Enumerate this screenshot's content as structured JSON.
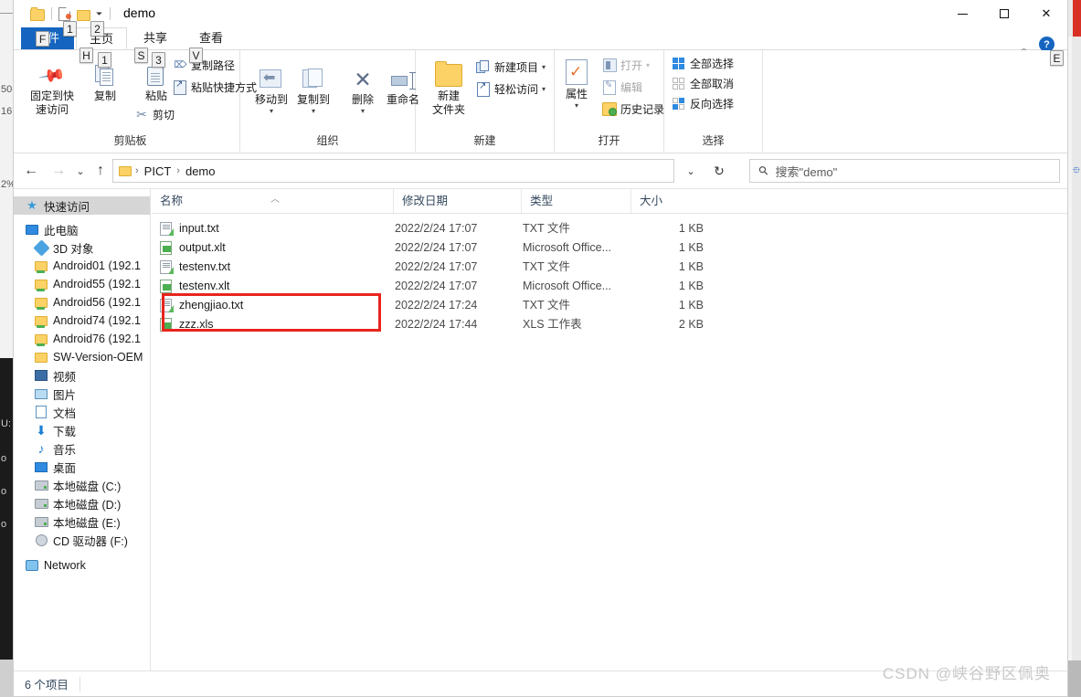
{
  "window": {
    "title": "demo",
    "minimize_label": "最小化",
    "maximize_label": "最大化",
    "close_label": "关闭",
    "help_label": "?",
    "help_keytip": "E",
    "collapse_ribbon_label": "︿"
  },
  "quick_access_toolbar": {
    "items": [
      {
        "name": "folder-icon",
        "keytip": ""
      },
      {
        "name": "properties-icon",
        "keytip": "1"
      },
      {
        "name": "new-folder-icon",
        "keytip": "2"
      }
    ],
    "dropdown_label": "⏷"
  },
  "ribbon": {
    "tabs": [
      {
        "label": "文件",
        "keytip": "F",
        "active": false
      },
      {
        "label": "主页",
        "keytip": "H",
        "active": true
      },
      {
        "label": "共享",
        "keytip": "S",
        "active": false
      },
      {
        "label": "查看",
        "keytip": "V",
        "active": false
      }
    ],
    "groups": [
      {
        "label": "剪贴板",
        "big_buttons": [
          {
            "label": "固定到快\n速访问",
            "line1": "固定到快",
            "line2": "速访问",
            "icon": "pin-icon"
          },
          {
            "label": "复制",
            "icon": "copy-icon",
            "keytip": "1"
          },
          {
            "label": "粘贴",
            "icon": "paste-icon",
            "keytip": "3"
          }
        ],
        "small_buttons": [
          {
            "label": "剪切",
            "icon": "scissors-icon"
          },
          {
            "label": "复制路径",
            "icon": "copy-path-icon"
          },
          {
            "label": "粘贴快捷方式",
            "icon": "paste-shortcut-icon"
          }
        ]
      },
      {
        "label": "组织",
        "big_buttons": [
          {
            "label": "移动到",
            "icon": "move-to-icon",
            "has_caret": true
          },
          {
            "label": "复制到",
            "icon": "copy-to-icon",
            "has_caret": true
          },
          {
            "label": "删除",
            "icon": "delete-icon",
            "has_caret": true
          },
          {
            "label": "重命名",
            "icon": "rename-icon"
          }
        ]
      },
      {
        "label": "新建",
        "big_buttons": [
          {
            "label": "新建\n文件夹",
            "line1": "新建",
            "line2": "文件夹",
            "icon": "new-folder-icon"
          }
        ],
        "small_buttons": [
          {
            "label": "新建项目",
            "icon": "new-item-icon",
            "has_caret": true
          },
          {
            "label": "轻松访问",
            "icon": "easy-access-icon",
            "has_caret": true
          }
        ]
      },
      {
        "label": "打开",
        "big_buttons": [
          {
            "label": "属性",
            "icon": "properties-icon",
            "has_caret": true
          }
        ],
        "small_buttons": [
          {
            "label": "打开",
            "icon": "open-icon",
            "has_caret": true,
            "disabled": true
          },
          {
            "label": "编辑",
            "icon": "edit-icon",
            "disabled": true
          },
          {
            "label": "历史记录",
            "icon": "history-icon"
          }
        ]
      },
      {
        "label": "选择",
        "small_buttons": [
          {
            "label": "全部选择",
            "icon": "select-all-icon"
          },
          {
            "label": "全部取消",
            "icon": "select-none-icon"
          },
          {
            "label": "反向选择",
            "icon": "invert-selection-icon"
          }
        ]
      }
    ]
  },
  "navigation": {
    "back_label": "←",
    "forward_label": "→",
    "recent_label": "⌄",
    "up_label": "↑",
    "breadcrumb": [
      "PICT",
      "demo"
    ],
    "breadcrumb_separator": "›",
    "address_dropdown_label": "⌄",
    "refresh_label": "↻"
  },
  "search": {
    "placeholder": "搜索\"demo\"",
    "icon": "search-icon"
  },
  "sidebar": {
    "items": [
      {
        "label": "快速访问",
        "icon": "star-icon",
        "level": 0,
        "selected": true
      },
      {
        "label": "此电脑",
        "icon": "this-pc-icon",
        "level": 0,
        "selected": false
      },
      {
        "label": "3D 对象",
        "icon": "3d-objects-icon",
        "level": 1,
        "selected": false
      },
      {
        "label": "Android01 (192.1",
        "icon": "network-folder-icon",
        "level": 1,
        "selected": false
      },
      {
        "label": "Android55 (192.1",
        "icon": "network-folder-icon",
        "level": 1,
        "selected": false
      },
      {
        "label": "Android56 (192.1",
        "icon": "network-folder-icon",
        "level": 1,
        "selected": false
      },
      {
        "label": "Android74 (192.1",
        "icon": "network-folder-icon",
        "level": 1,
        "selected": false
      },
      {
        "label": "Android76 (192.1",
        "icon": "network-folder-icon",
        "level": 1,
        "selected": false
      },
      {
        "label": "SW-Version-OEM",
        "icon": "folder-icon",
        "level": 1,
        "selected": false
      },
      {
        "label": "视频",
        "icon": "videos-icon",
        "level": 1,
        "selected": false
      },
      {
        "label": "图片",
        "icon": "pictures-icon",
        "level": 1,
        "selected": false
      },
      {
        "label": "文档",
        "icon": "documents-icon",
        "level": 1,
        "selected": false
      },
      {
        "label": "下载",
        "icon": "downloads-icon",
        "level": 1,
        "selected": false
      },
      {
        "label": "音乐",
        "icon": "music-icon",
        "level": 1,
        "selected": false
      },
      {
        "label": "桌面",
        "icon": "desktop-icon",
        "level": 1,
        "selected": false
      },
      {
        "label": "本地磁盘 (C:)",
        "icon": "drive-icon",
        "level": 1,
        "selected": false
      },
      {
        "label": "本地磁盘 (D:)",
        "icon": "drive-icon",
        "level": 1,
        "selected": false
      },
      {
        "label": "本地磁盘 (E:)",
        "icon": "drive-icon",
        "level": 1,
        "selected": false
      },
      {
        "label": "CD 驱动器 (F:)",
        "icon": "cd-drive-icon",
        "level": 1,
        "selected": false
      },
      {
        "label": "Network",
        "icon": "network-icon",
        "level": 0,
        "selected": false
      }
    ]
  },
  "file_list": {
    "columns": [
      {
        "label": "名称",
        "sorted": "asc"
      },
      {
        "label": "修改日期"
      },
      {
        "label": "类型"
      },
      {
        "label": "大小"
      }
    ],
    "rows": [
      {
        "name": "input.txt",
        "date": "2022/2/24 17:07",
        "type": "TXT 文件",
        "size": "1 KB",
        "icon": "txt-file-icon",
        "highlighted": false
      },
      {
        "name": "output.xlt",
        "date": "2022/2/24 17:07",
        "type": "Microsoft Office...",
        "size": "1 KB",
        "icon": "excel-file-icon",
        "highlighted": false
      },
      {
        "name": "testenv.txt",
        "date": "2022/2/24 17:07",
        "type": "TXT 文件",
        "size": "1 KB",
        "icon": "txt-file-icon",
        "highlighted": false
      },
      {
        "name": "testenv.xlt",
        "date": "2022/2/24 17:07",
        "type": "Microsoft Office...",
        "size": "1 KB",
        "icon": "excel-file-icon",
        "highlighted": false
      },
      {
        "name": "zhengjiao.txt",
        "date": "2022/2/24 17:24",
        "type": "TXT 文件",
        "size": "1 KB",
        "icon": "txt-file-icon",
        "highlighted": false
      },
      {
        "name": "zzz.xls",
        "date": "2022/2/24 17:44",
        "type": "XLS 工作表",
        "size": "2 KB",
        "icon": "excel-file-icon",
        "highlighted": true
      }
    ],
    "annotation_color": "#e8251d"
  },
  "status_bar": {
    "item_count": "6 个项目"
  },
  "watermark": {
    "text": "CSDN @峡谷野区佩奥"
  }
}
